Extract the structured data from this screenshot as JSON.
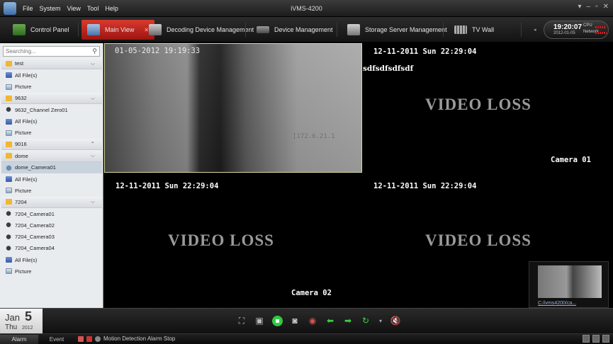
{
  "menu": {
    "items": [
      "File",
      "System",
      "View",
      "Tool",
      "Help"
    ]
  },
  "window": {
    "title": "iVMS-4200",
    "controls": [
      "▾",
      "–",
      "▫",
      "✕"
    ]
  },
  "tabs": [
    {
      "label": "Control Panel",
      "active": false,
      "icon": "control-panel-icon"
    },
    {
      "label": "Main View",
      "active": true,
      "icon": "main-view-icon"
    },
    {
      "label": "Decoding Device Management",
      "active": false,
      "icon": "decoding-icon"
    },
    {
      "label": "Device Management",
      "active": false,
      "icon": "device-icon"
    },
    {
      "label": "Storage Server Management",
      "active": false,
      "icon": "storage-icon"
    },
    {
      "label": "TV Wall",
      "active": false,
      "icon": "tv-wall-icon"
    }
  ],
  "status_clock": {
    "time": "19:20:07",
    "date": "2012-01-05",
    "cpu_label": "CPU",
    "network_label": "Network"
  },
  "search": {
    "placeholder": "Searching..."
  },
  "tree": [
    {
      "label": "test",
      "type": "group"
    },
    {
      "label": "All File(s)",
      "type": "files"
    },
    {
      "label": "Picture",
      "type": "picture"
    },
    {
      "label": "9632",
      "type": "group"
    },
    {
      "label": "9632_Channel Zero01",
      "type": "camera"
    },
    {
      "label": "All File(s)",
      "type": "files"
    },
    {
      "label": "Picture",
      "type": "picture"
    },
    {
      "label": "9016",
      "type": "group-collapsed"
    },
    {
      "label": "dome",
      "type": "group"
    },
    {
      "label": "dome_Camera01",
      "type": "dome",
      "selected": true
    },
    {
      "label": "All File(s)",
      "type": "files"
    },
    {
      "label": "Picture",
      "type": "picture"
    },
    {
      "label": "7204",
      "type": "group"
    },
    {
      "label": "7204_Camera01",
      "type": "camera"
    },
    {
      "label": "7204_Camera02",
      "type": "camera"
    },
    {
      "label": "7204_Camera03",
      "type": "camera"
    },
    {
      "label": "7204_Camera04",
      "type": "camera"
    },
    {
      "label": "All File(s)",
      "type": "files"
    },
    {
      "label": "Picture",
      "type": "picture"
    }
  ],
  "video": {
    "live": {
      "timestamp": "01-05-2012 19:19:33",
      "ip": "[172.6.21.1"
    },
    "cell2": {
      "timestamp": "12-11-2011 Sun 22:29:04",
      "text": "sdfsdfsdfsdf",
      "status": "VIDEO LOSS",
      "camera": "Camera 01"
    },
    "cell3": {
      "timestamp": "12-11-2011 Sun 22:29:04",
      "status": "VIDEO LOSS",
      "camera": "Camera 02"
    },
    "cell4": {
      "timestamp": "12-11-2011 Sun 22:29:04",
      "status": "VIDEO LOSS"
    },
    "preview_link": "C:/ivms4200/ca..."
  },
  "date_panel": {
    "month": "Jan",
    "day": "5",
    "weekday": "Thu",
    "year": "2012"
  },
  "statusbar": {
    "alarm_tab": "Alarm",
    "event_tab": "Event",
    "message": "Motion Detection Alarm Stop"
  }
}
